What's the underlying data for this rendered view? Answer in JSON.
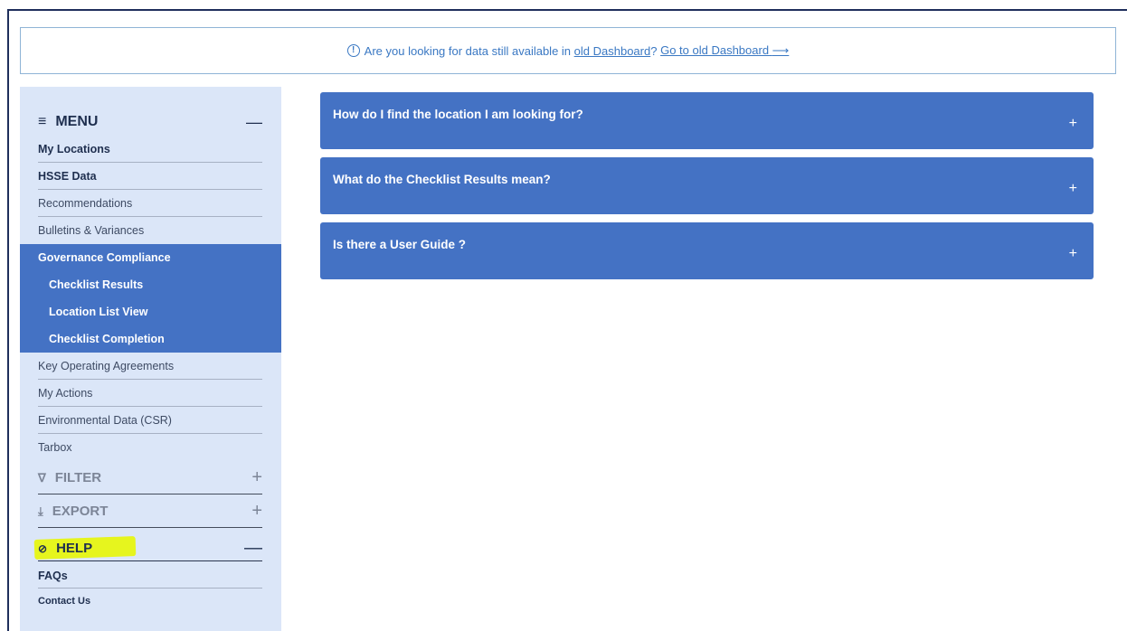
{
  "banner": {
    "text_before": "Are you looking for data still available in",
    "link_old_dashboard": "old Dashboard",
    "question_mark": "?",
    "link_go_to": "Go to old Dashboard",
    "arrow": "⟶"
  },
  "menu": {
    "title": "MENU",
    "hamburger": "≡",
    "collapse": "—",
    "items": [
      {
        "label": "My Locations"
      },
      {
        "label": "HSSE Data"
      },
      {
        "label": "Recommendations"
      },
      {
        "label": "Bulletins & Variances"
      },
      {
        "label": "Governance Compliance"
      },
      {
        "label": "Checklist Results"
      },
      {
        "label": "Location List View"
      },
      {
        "label": "Checklist Completion"
      },
      {
        "label": "Key Operating Agreements"
      },
      {
        "label": "My Actions"
      },
      {
        "label": "Environmental Data (CSR)"
      },
      {
        "label": "Tarbox"
      }
    ]
  },
  "filter": {
    "label": "FILTER",
    "icon": "∇",
    "toggle": "+"
  },
  "export": {
    "label": "EXPORT",
    "icon": "⤓",
    "toggle": "+"
  },
  "help": {
    "label": "HELP",
    "icon": "⊘",
    "toggle": "—",
    "items": [
      {
        "label": "FAQs"
      },
      {
        "label": "Contact Us"
      }
    ]
  },
  "faqs": [
    {
      "question": "How do I find the location I am looking for?",
      "toggle": "+"
    },
    {
      "question": "What do the Checklist Results mean?",
      "toggle": "+"
    },
    {
      "question": "Is there a User Guide ?",
      "toggle": "+"
    }
  ],
  "colors": {
    "accent": "#4472c4",
    "sidebar_bg": "#dbe6f8",
    "link": "#3a78c3",
    "highlight": "#e6f51e"
  }
}
